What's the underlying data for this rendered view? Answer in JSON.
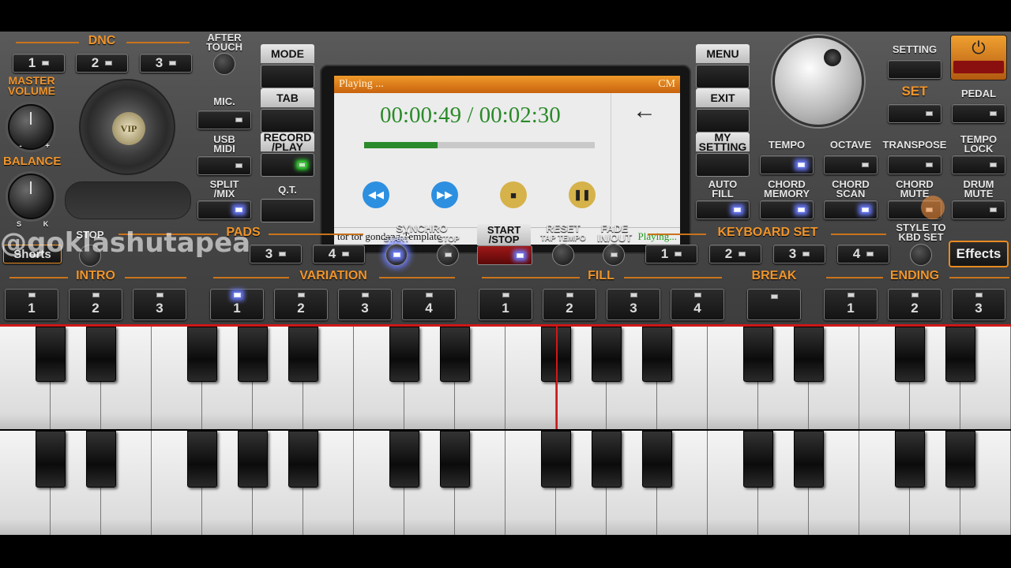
{
  "dnc": {
    "title": "DNC",
    "buttons": [
      "1",
      "2",
      "3"
    ]
  },
  "after_touch": "AFTER\nTOUCH",
  "master_volume": "MASTER\nVOLUME",
  "balance": "BALANCE",
  "balance_marks": {
    "left": "S",
    "right": "K",
    "minus": "-",
    "plus": "+"
  },
  "logo_text": "VIP",
  "left_labels": {
    "mic": "MIC.",
    "usb_midi": "USB\nMIDI",
    "split_mix": "SPLIT\n/MIX"
  },
  "center_left": {
    "mode": "MODE",
    "tab": "TAB",
    "record_play": "RECORD\n/PLAY",
    "qt": "Q.T."
  },
  "lcd": {
    "status": "Playing ...",
    "cm": "CM",
    "time": "00:00:49 / 00:02:30",
    "progress": 0.32,
    "back_icon": "arrow-left-icon",
    "file": "tor tor gondang.Template",
    "state": "Playing..."
  },
  "right_side": {
    "menu": "MENU",
    "exit": "EXIT",
    "my_setting": "MY\nSETTING",
    "auto_fill": "AUTO\nFILL"
  },
  "top_right": {
    "setting": "SETTING",
    "set": "SET",
    "pedal": "PEDAL"
  },
  "row2_labels": {
    "tempo": "TEMPO",
    "octave": "OCTAVE",
    "transpose": "TRANSPOSE",
    "tempo_lock": "TEMPO\nLOCK"
  },
  "row3_labels": {
    "chord_memory": "CHORD\nMEMORY",
    "chord_scan": "CHORD\nSCAN",
    "chord_mute": "CHORD\nMUTE",
    "drum_mute": "DRUM\nMUTE"
  },
  "pads": {
    "title": "PADS",
    "stop": "STOP",
    "buttons": [
      "3",
      "4"
    ]
  },
  "synchro": {
    "title": "SYNCHRO",
    "start": "START",
    "stop": "STOP"
  },
  "start_stop": "START\n/STOP",
  "reset": "RESET",
  "tap_tempo": "TAP TEMPO",
  "fade": "FADE\nIN/OUT",
  "keyboard_set": {
    "title": "KEYBOARD SET",
    "buttons": [
      "1",
      "2",
      "3",
      "4"
    ]
  },
  "style_to_kbd": "STYLE TO\nKBD SET",
  "effects": "Effects",
  "shorts": "Shorts",
  "sections": {
    "intro": {
      "title": "INTRO",
      "buttons": [
        "1",
        "2",
        "3"
      ]
    },
    "variation": {
      "title": "VARIATION",
      "buttons": [
        "1",
        "2",
        "3",
        "4"
      ]
    },
    "fill": {
      "title": "FILL",
      "buttons": [
        "1",
        "2",
        "3",
        "4"
      ]
    },
    "break": {
      "title": "BREAK"
    },
    "ending": {
      "title": "ENDING",
      "buttons": [
        "1",
        "2",
        "3"
      ]
    }
  },
  "watermark": "@goklashutapea",
  "colors": {
    "accent": "#f0952b",
    "lcd_green": "#2a8a2a",
    "led_glow": "#6c7cff"
  }
}
